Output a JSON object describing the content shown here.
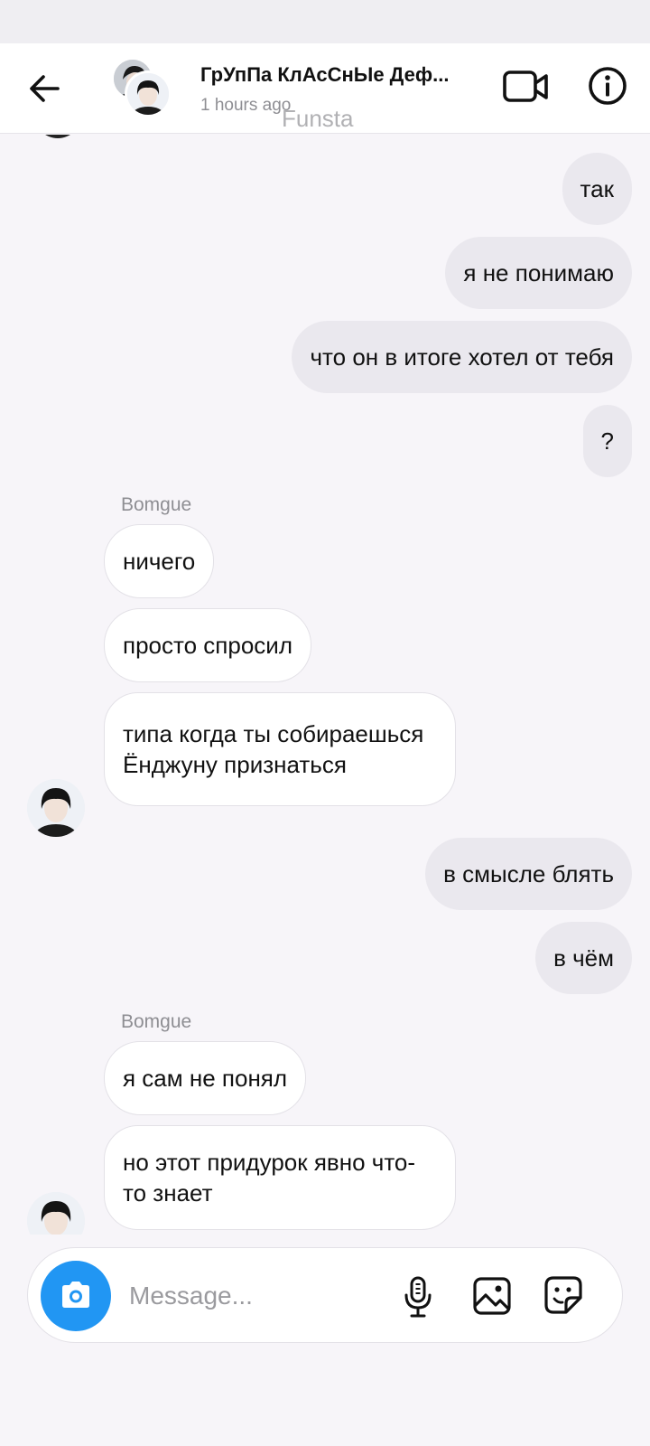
{
  "header": {
    "title": "ГрУпПа КлАсСнЫе Деф...",
    "subtitle": "1 hours ago",
    "watermark": "Funsta",
    "icons": {
      "back": "arrow-left-icon",
      "video": "video-camera-icon",
      "info": "info-icon"
    }
  },
  "messages": [
    {
      "direction": "out",
      "text": "так"
    },
    {
      "direction": "out",
      "text": "я не понимаю"
    },
    {
      "direction": "out",
      "text": "что он в итоге хотел от тебя"
    },
    {
      "direction": "out",
      "text": "?"
    },
    {
      "direction": "in",
      "sender": "Bomgue",
      "text": "ничего"
    },
    {
      "direction": "in",
      "text": "просто спросил"
    },
    {
      "direction": "in",
      "text": "типа когда ты собираешься Ёнджуну признаться"
    },
    {
      "direction": "out",
      "text": "в смысле блять"
    },
    {
      "direction": "out",
      "text": "в чём"
    },
    {
      "direction": "in",
      "sender": "Bomgue",
      "text": "я сам не понял"
    },
    {
      "direction": "in",
      "text": "но этот придурок явно что-то знает"
    }
  ],
  "composer": {
    "placeholder": "Message...",
    "icons": {
      "camera": "camera-icon",
      "mic": "microphone-icon",
      "gallery": "image-gallery-icon",
      "sticker": "sticker-icon"
    },
    "camera_color": "#2196f3"
  },
  "colors": {
    "outgoing_bubble": "#eae8ee",
    "incoming_bubble": "#ffffff",
    "background": "#f7f5f9"
  }
}
